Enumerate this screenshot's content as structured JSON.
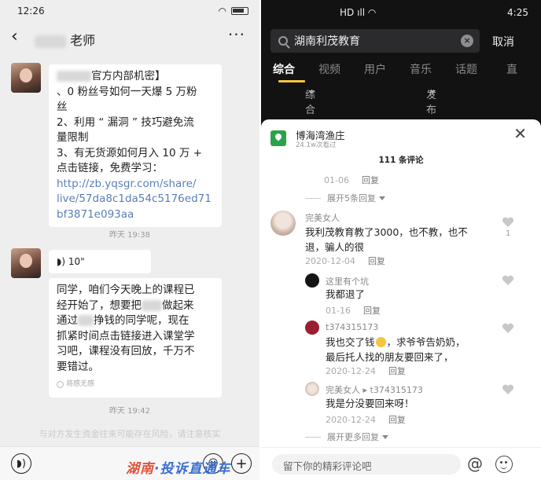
{
  "left": {
    "status_time": "12:26",
    "chat_title": "老师",
    "msg1": {
      "l1": "官方内部机密】",
      "l2": "、0 粉丝号如何一天爆 5 万粉",
      "l3": "丝",
      "l4": "2、利用 “ 漏洞 ” 技巧避免流",
      "l5": "量限制",
      "l6": "3、有无货源如何月入 10 万 +",
      "l7": "点击链接，免费学习：",
      "link1": "http://zb.yqsgr.com/share/",
      "link2": "live/57da8c1da54c5176ed71",
      "link3": "bf3871e093aa"
    },
    "time1": "昨天 19:38",
    "voice_length": "10\"",
    "msg3": {
      "l1": "同学，咱们今天晚上的课程已",
      "l2": "经开始了，想要把",
      "l2b": "做起来",
      "l3": "通过",
      "l3b": "挣钱的同学呢，现在",
      "l4": "抓紧时间点击链接进入课堂学",
      "l5": "习吧，课程没有回放，千万不",
      "l6": "要错过。",
      "seen": "将感无感"
    },
    "time2": "昨天 19:42",
    "risk_notice": "与对方发生资金往来可能存在风险，请注意核实",
    "watermark_a": "湖南",
    "watermark_b": "·投诉直通车"
  },
  "right": {
    "status_time": "4:25",
    "search_query": "湖南利茂教育",
    "cancel": "取消",
    "tabs": [
      "综合",
      "视频",
      "用户",
      "音乐",
      "话题",
      "直"
    ],
    "filter_sort": "综合排序",
    "filter_time": "发布时间",
    "account_name": "博海湾渔庄",
    "account_views": "24.1w次看过",
    "comment_count": "111 条评论",
    "reply_label": "回复",
    "c0_date": "01-06",
    "expand5": "展开5条回复",
    "c1": {
      "name": "完美女人",
      "text1": "我利茂教育教了3000，也不教，也不",
      "text2": "退，骗人的很",
      "date": "2020-12-04",
      "likes": "1"
    },
    "r1": {
      "name": "这里有个坑",
      "text": "我都退了",
      "date": "01-16"
    },
    "r2": {
      "name": "t374315173",
      "text1a": "我也交了钱",
      "text1b": "，求爷爷告奶奶，",
      "text2": "最后托人找的朋友要回来了，",
      "date": "2020-12-24"
    },
    "r3": {
      "name": "完美女人 ▸ t374315173",
      "text": "我是分没要回来呀！",
      "date": "2020-12-24"
    },
    "expand_more": "展开更多回复",
    "input_placeholder": "留下你的精彩评论吧",
    "colors": {
      "accent": "#f5c744",
      "account_logo": "#2aa34a"
    }
  }
}
